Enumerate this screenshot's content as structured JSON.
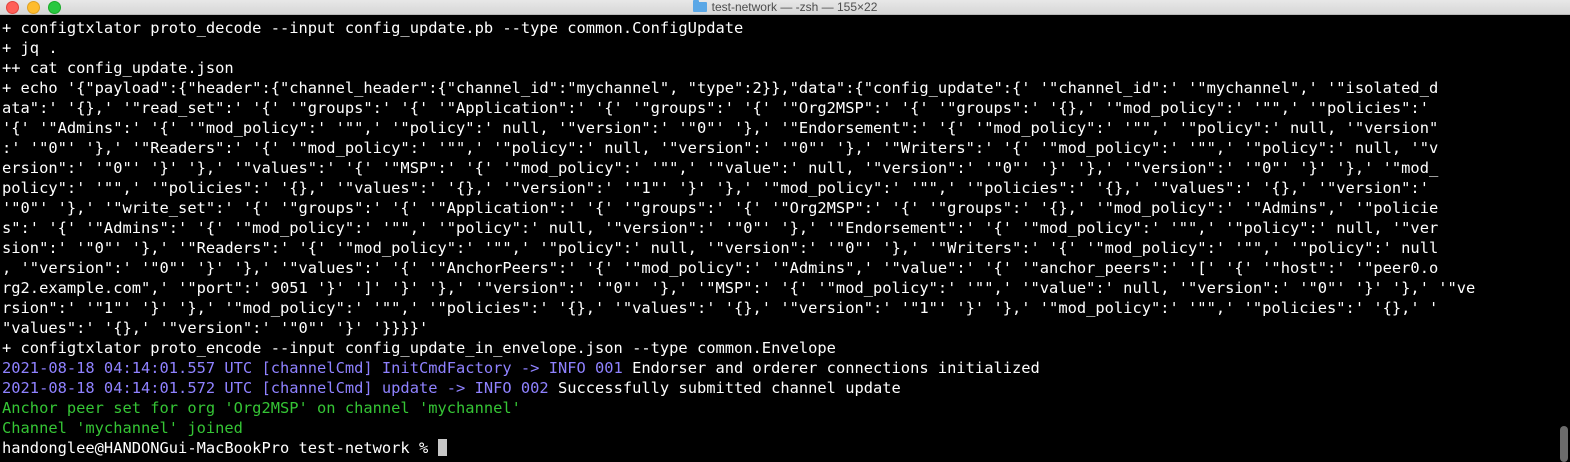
{
  "window": {
    "title": "test-network — -zsh — 155×22"
  },
  "terminal": {
    "lines": [
      "+ configtxlator proto_decode --input config_update.pb --type common.ConfigUpdate",
      "+ jq .",
      "++ cat config_update.json",
      "+ echo '{\"payload\":{\"header\":{\"channel_header\":{\"channel_id\":\"mychannel\", \"type\":2}},\"data\":{\"config_update\":{' '\"channel_id\":' '\"mychannel\",' '\"isolated_d",
      "ata\":' '{},' '\"read_set\":' '{' '\"groups\":' '{' '\"Application\":' '{' '\"groups\":' '{' '\"Org2MSP\":' '{' '\"groups\":' '{},' '\"mod_policy\":' '\"\",' '\"policies\":'",
      "'{' '\"Admins\":' '{' '\"mod_policy\":' '\"\",' '\"policy\":' null, '\"version\":' '\"0\"' '},' '\"Endorsement\":' '{' '\"mod_policy\":' '\"\",' '\"policy\":' null, '\"version\"",
      ":' '\"0\"' '},' '\"Readers\":' '{' '\"mod_policy\":' '\"\",' '\"policy\":' null, '\"version\":' '\"0\"' '},' '\"Writers\":' '{' '\"mod_policy\":' '\"\",' '\"policy\":' null, '\"v",
      "ersion\":' '\"0\"' '}' '},' '\"values\":' '{' '\"MSP\":' '{' '\"mod_policy\":' '\"\",' '\"value\":' null, '\"version\":' '\"0\"' '}' '},' '\"version\":' '\"0\"' '}' '},' '\"mod_",
      "policy\":' '\"\",' '\"policies\":' '{},' '\"values\":' '{},' '\"version\":' '\"1\"' '}' '},' '\"mod_policy\":' '\"\",' '\"policies\":' '{},' '\"values\":' '{},' '\"version\":'",
      "'\"0\"' '},' '\"write_set\":' '{' '\"groups\":' '{' '\"Application\":' '{' '\"groups\":' '{' '\"Org2MSP\":' '{' '\"groups\":' '{},' '\"mod_policy\":' '\"Admins\",' '\"policie",
      "s\":' '{' '\"Admins\":' '{' '\"mod_policy\":' '\"\",' '\"policy\":' null, '\"version\":' '\"0\"' '},' '\"Endorsement\":' '{' '\"mod_policy\":' '\"\",' '\"policy\":' null, '\"ver",
      "sion\":' '\"0\"' '},' '\"Readers\":' '{' '\"mod_policy\":' '\"\",' '\"policy\":' null, '\"version\":' '\"0\"' '},' '\"Writers\":' '{' '\"mod_policy\":' '\"\",' '\"policy\":' null",
      ", '\"version\":' '\"0\"' '}' '},' '\"values\":' '{' '\"AnchorPeers\":' '{' '\"mod_policy\":' '\"Admins\",' '\"value\":' '{' '\"anchor_peers\":' '[' '{' '\"host\":' '\"peer0.o",
      "rg2.example.com\",' '\"port\":' 9051 '}' ']' '}' '},' '\"version\":' '\"0\"' '},' '\"MSP\":' '{' '\"mod_policy\":' '\"\",' '\"value\":' null, '\"version\":' '\"0\"' '}' '},' '\"ve",
      "rsion\":' '\"1\"' '}' '},' '\"mod_policy\":' '\"\",' '\"policies\":' '{},' '\"values\":' '{},' '\"version\":' '\"1\"' '}' '},' '\"mod_policy\":' '\"\",' '\"policies\":' '{},' '",
      "\"values\":' '{},' '\"version\":' '\"0\"' '}' '}}}}'",
      "+ configtxlator proto_encode --input config_update_in_envelope.json --type common.Envelope"
    ],
    "log1": {
      "prefix": "2021-08-18 04:14:01.557 UTC [channelCmd] InitCmdFactory -> INFO 001",
      "message": " Endorser and orderer connections initialized"
    },
    "log2": {
      "prefix": "2021-08-18 04:14:01.572 UTC [channelCmd] update -> INFO 002",
      "message": " Successfully submitted channel update"
    },
    "success1": "Anchor peer set for org 'Org2MSP' on channel 'mychannel'",
    "success2": "Channel 'mychannel' joined",
    "prompt": "handonglee@HANDONGui-MacBookPro test-network % "
  },
  "colors": {
    "log_prefix": "#8f82ff",
    "success": "#35c535",
    "text": "#ffffff",
    "background": "#000000"
  }
}
